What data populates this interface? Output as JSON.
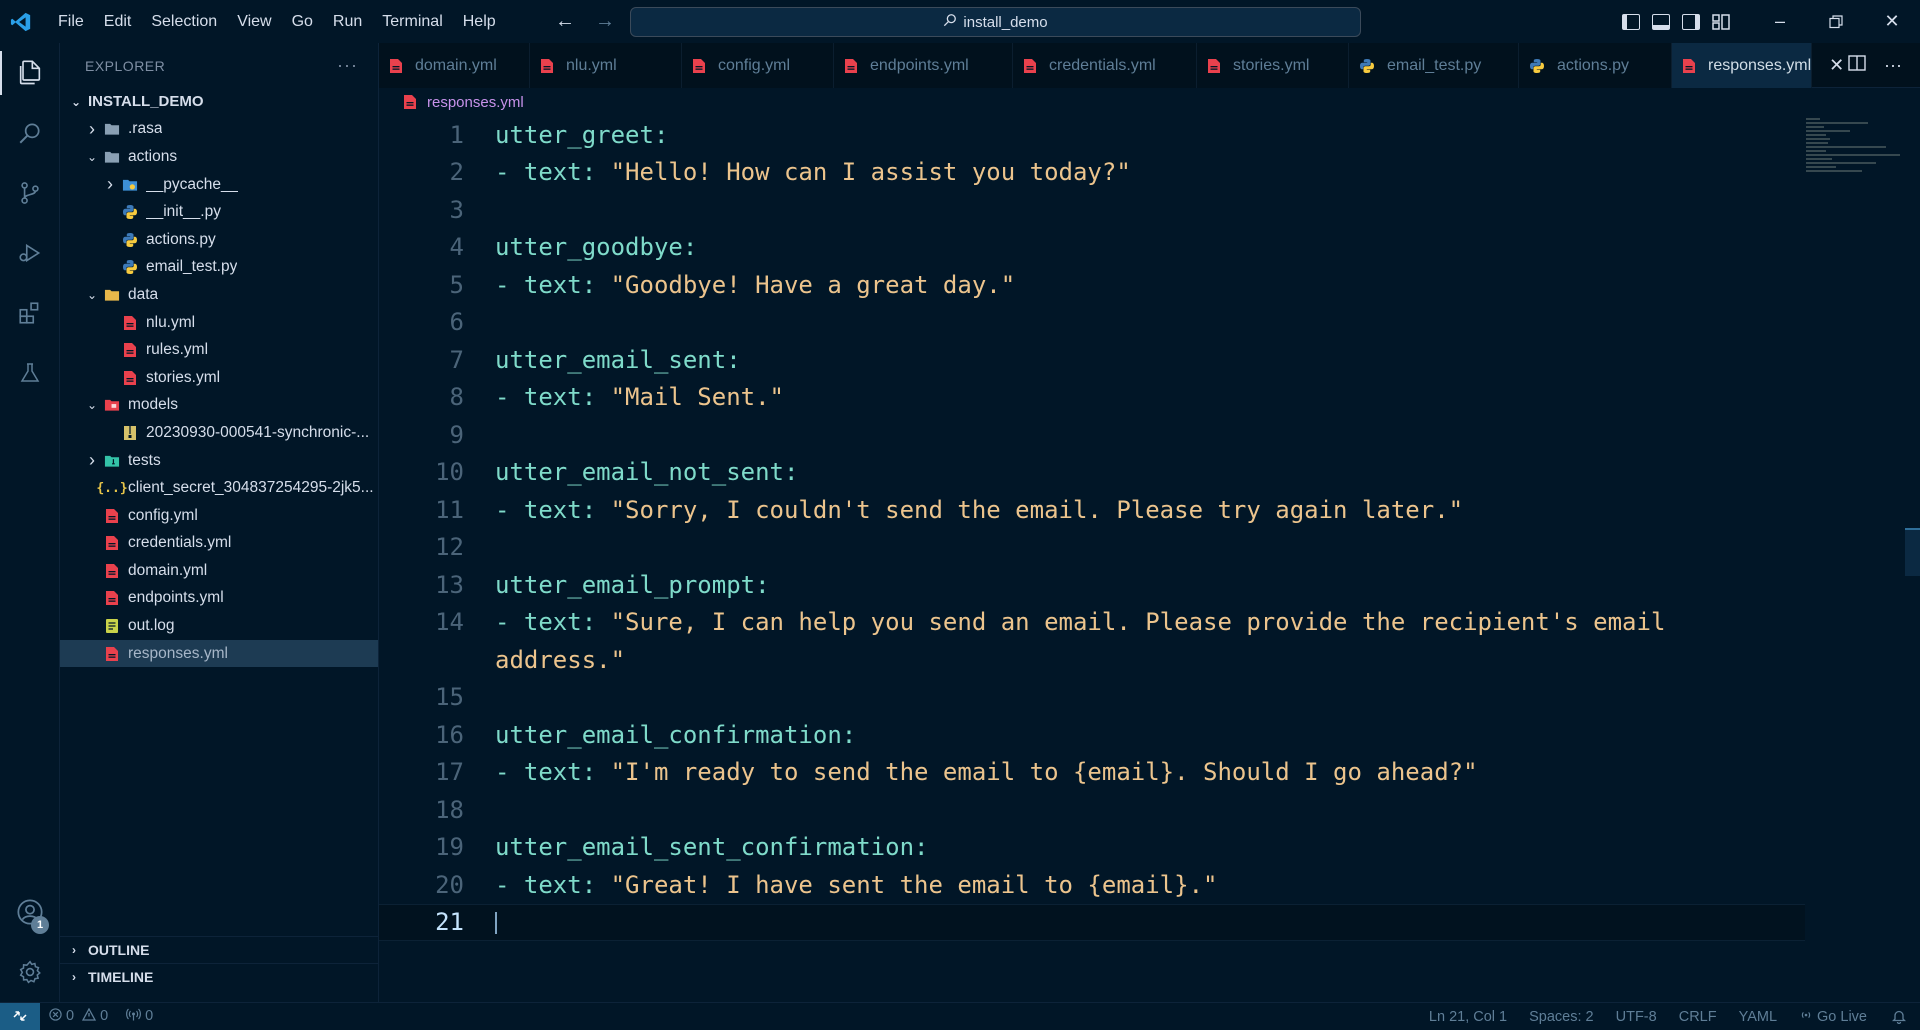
{
  "titlebar": {
    "menu": [
      "File",
      "Edit",
      "Selection",
      "View",
      "Go",
      "Run",
      "Terminal",
      "Help"
    ],
    "search": "install_demo"
  },
  "sidebar": {
    "title": "EXPLORER",
    "more": "···",
    "root": "INSTALL_DEMO",
    "items": [
      {
        "label": ".rasa",
        "kind": "folder",
        "state": "collapsed",
        "depth": 1
      },
      {
        "label": "actions",
        "kind": "folder",
        "state": "expanded",
        "depth": 1
      },
      {
        "label": "__pycache__",
        "kind": "folder-blue",
        "state": "collapsed",
        "depth": 2
      },
      {
        "label": "__init__.py",
        "kind": "python",
        "depth": 2
      },
      {
        "label": "actions.py",
        "kind": "python",
        "depth": 2
      },
      {
        "label": "email_test.py",
        "kind": "python",
        "depth": 2
      },
      {
        "label": "data",
        "kind": "folder-yellow",
        "state": "expanded",
        "depth": 1
      },
      {
        "label": "nlu.yml",
        "kind": "yaml",
        "depth": 2
      },
      {
        "label": "rules.yml",
        "kind": "yaml",
        "depth": 2
      },
      {
        "label": "stories.yml",
        "kind": "yaml",
        "depth": 2
      },
      {
        "label": "models",
        "kind": "folder-red",
        "state": "expanded",
        "depth": 1
      },
      {
        "label": "20230930-000541-synchronic-...",
        "kind": "archive",
        "depth": 2
      },
      {
        "label": "tests",
        "kind": "folder-green",
        "state": "collapsed",
        "depth": 1
      },
      {
        "label": "client_secret_304837254295-2jk5...",
        "kind": "json",
        "depth": 1
      },
      {
        "label": "config.yml",
        "kind": "yaml",
        "depth": 1
      },
      {
        "label": "credentials.yml",
        "kind": "yaml",
        "depth": 1
      },
      {
        "label": "domain.yml",
        "kind": "yaml",
        "depth": 1
      },
      {
        "label": "endpoints.yml",
        "kind": "yaml",
        "depth": 1
      },
      {
        "label": "out.log",
        "kind": "log",
        "depth": 1
      },
      {
        "label": "responses.yml",
        "kind": "yaml",
        "depth": 1,
        "selected": true
      }
    ],
    "outline": "OUTLINE",
    "timeline": "TIMELINE"
  },
  "tabs": [
    {
      "label": "domain.yml",
      "kind": "yaml"
    },
    {
      "label": "nlu.yml",
      "kind": "yaml"
    },
    {
      "label": "config.yml",
      "kind": "yaml"
    },
    {
      "label": "endpoints.yml",
      "kind": "yaml"
    },
    {
      "label": "credentials.yml",
      "kind": "yaml"
    },
    {
      "label": "stories.yml",
      "kind": "yaml"
    },
    {
      "label": "email_test.py",
      "kind": "python"
    },
    {
      "label": "actions.py",
      "kind": "python"
    },
    {
      "label": "responses.yml",
      "kind": "yaml",
      "active": true
    }
  ],
  "breadcrumb": "responses.yml",
  "editor": {
    "current_line": 21,
    "lines": [
      {
        "n": "1",
        "key": "utter_greet",
        "text": ""
      },
      {
        "n": "2",
        "key": "",
        "text": "\"Hello! How can I assist you today?\""
      },
      {
        "n": "3",
        "key": "",
        "text": ""
      },
      {
        "n": "4",
        "key": "utter_goodbye",
        "text": ""
      },
      {
        "n": "5",
        "key": "",
        "text": "\"Goodbye! Have a great day.\""
      },
      {
        "n": "6",
        "key": "",
        "text": ""
      },
      {
        "n": "7",
        "key": "utter_email_sent",
        "text": ""
      },
      {
        "n": "8",
        "key": "",
        "text": "\"Mail Sent.\""
      },
      {
        "n": "9",
        "key": "",
        "text": ""
      },
      {
        "n": "10",
        "key": "utter_email_not_sent",
        "text": ""
      },
      {
        "n": "11",
        "key": "",
        "text": "\"Sorry, I couldn't send the email. Please try again later.\""
      },
      {
        "n": "12",
        "key": "",
        "text": ""
      },
      {
        "n": "13",
        "key": "utter_email_prompt",
        "text": ""
      },
      {
        "n": "14",
        "key": "",
        "text": "\"Sure, I can help you send an email. Please provide the recipient's email"
      },
      {
        "n": "",
        "key": "",
        "text": "address.\"",
        "wrap": true
      },
      {
        "n": "15",
        "key": "",
        "text": ""
      },
      {
        "n": "16",
        "key": "utter_email_confirmation",
        "text": ""
      },
      {
        "n": "17",
        "key": "",
        "text": "\"I'm ready to send the email to {email}. Should I go ahead?\""
      },
      {
        "n": "18",
        "key": "",
        "text": ""
      },
      {
        "n": "19",
        "key": "utter_email_sent_confirmation",
        "text": ""
      },
      {
        "n": "20",
        "key": "",
        "text": "\"Great! I have sent the email to {email}.\""
      },
      {
        "n": "21",
        "key": "",
        "text": "",
        "current": true
      }
    ]
  },
  "statusbar": {
    "errors": "0",
    "warnings": "0",
    "ports": "0",
    "position": "Ln 21, Col 1",
    "spaces": "Spaces: 2",
    "encoding": "UTF-8",
    "eol": "CRLF",
    "language": "YAML",
    "golive": "Go Live"
  },
  "accounts_badge": "1",
  "colors": {
    "background": "#011627",
    "key": "#7fdbca",
    "string": "#ecc48d",
    "yaml_icon": "#e9414d",
    "breadcrumb": "#c792ea"
  }
}
